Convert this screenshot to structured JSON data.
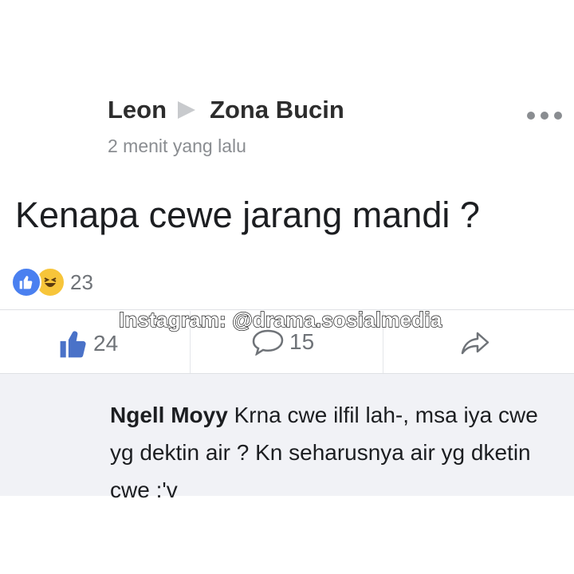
{
  "post": {
    "author": "Leon",
    "group": "Zona Bucin",
    "time": "2 menit yang lalu",
    "text": "Kenapa cewe jarang mandi ?"
  },
  "reactions": {
    "types": [
      "like",
      "haha"
    ],
    "count": "23"
  },
  "actions": {
    "like_count": "24",
    "comment_count": "15"
  },
  "watermark": "Instagram: @drama.sosialmedia",
  "comment": {
    "author": "Ngell Moyy",
    "text": "Krna cwe ilfil lah-, msa iya cwe yg dektin air ? Kn seharusnya air yg dketin cwe :'v"
  },
  "colors": {
    "like_blue": "#4a80f0",
    "haha_yellow": "#f7c53a",
    "muted": "#6f7378"
  }
}
